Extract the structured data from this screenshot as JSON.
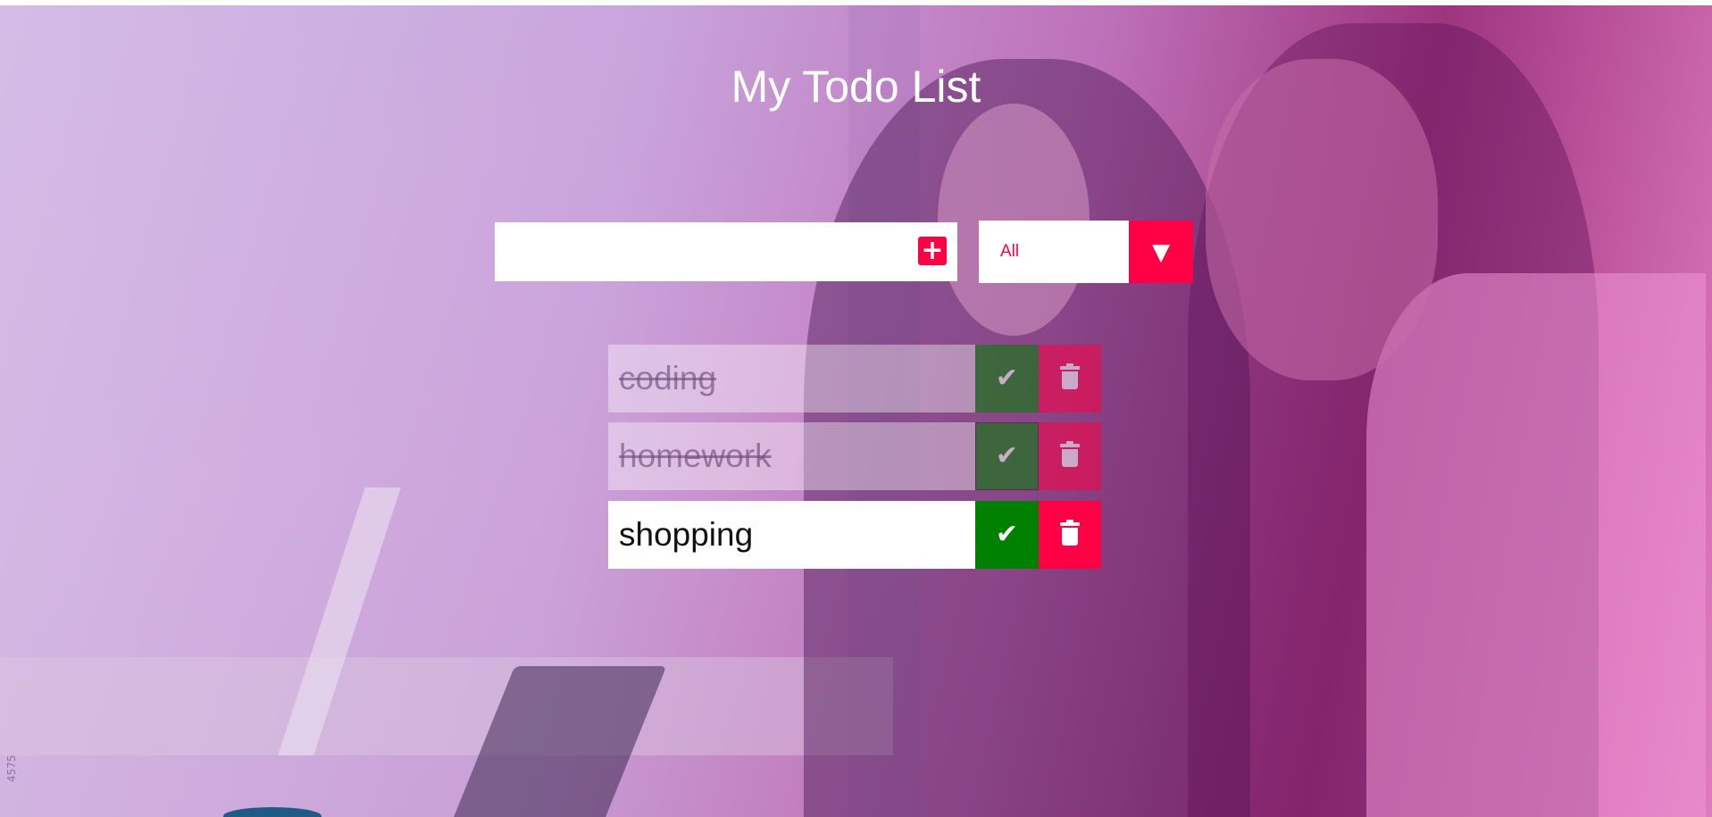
{
  "page": {
    "title": "My Todo List"
  },
  "form": {
    "input_value": "",
    "add_icon": "plus-icon",
    "filter": {
      "selected": "All",
      "arrow_icon": "caret-down-icon"
    }
  },
  "todos": [
    {
      "text": "coding",
      "completed": true
    },
    {
      "text": "homework",
      "completed": true
    },
    {
      "text": "shopping",
      "completed": false
    }
  ],
  "icons": {
    "check": "check-icon",
    "trash": "trash-icon"
  },
  "colors": {
    "accent": "#ff0044",
    "complete": "#008000",
    "title": "#ffffff"
  },
  "background": {
    "watermark": "4575"
  }
}
